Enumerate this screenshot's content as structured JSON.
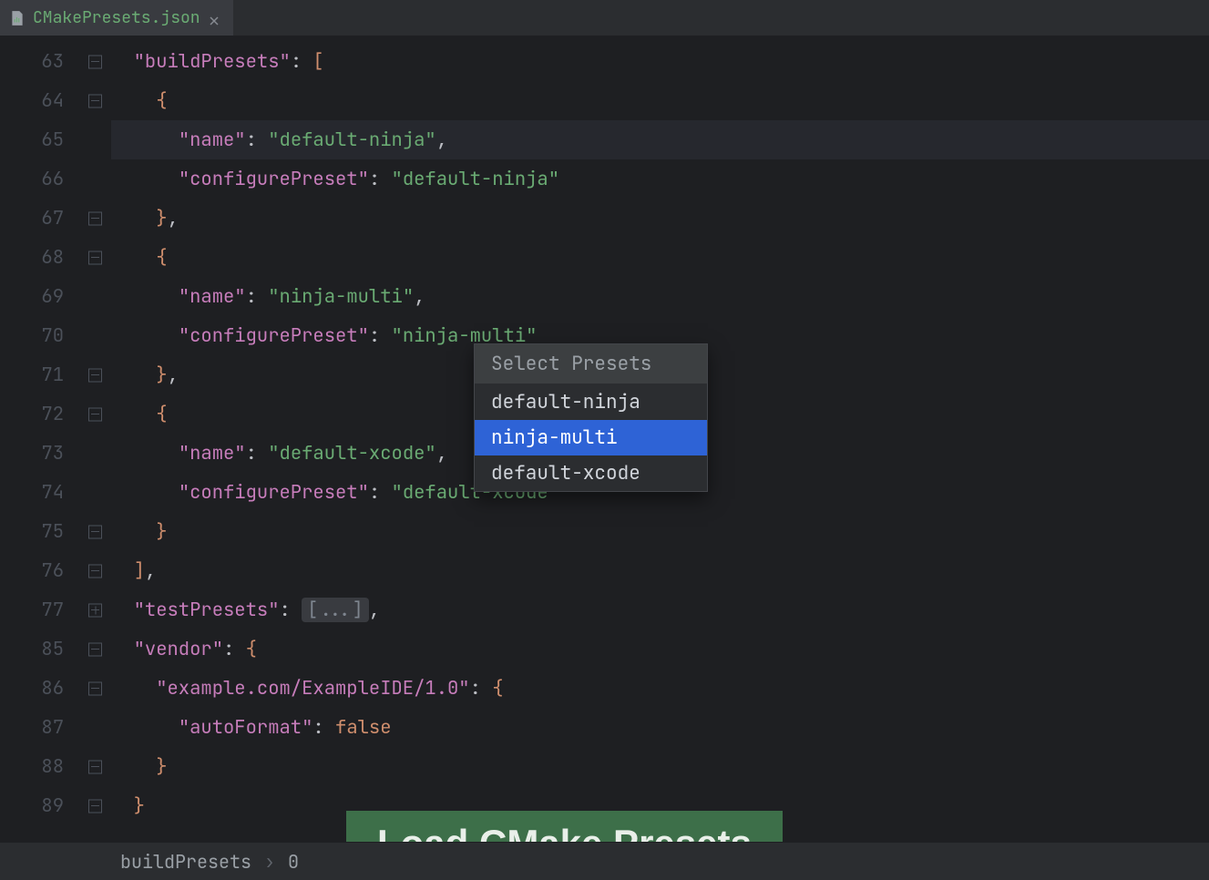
{
  "tab": {
    "filename": "CMakePresets.json"
  },
  "inspection_status": "ok",
  "gutter": [
    {
      "n": "63",
      "marker": "minus"
    },
    {
      "n": "64",
      "marker": "minus"
    },
    {
      "n": "65",
      "marker": null
    },
    {
      "n": "66",
      "marker": null
    },
    {
      "n": "67",
      "marker": "minus"
    },
    {
      "n": "68",
      "marker": "minus"
    },
    {
      "n": "69",
      "marker": null
    },
    {
      "n": "70",
      "marker": null
    },
    {
      "n": "71",
      "marker": "minus"
    },
    {
      "n": "72",
      "marker": "minus"
    },
    {
      "n": "73",
      "marker": null
    },
    {
      "n": "74",
      "marker": null
    },
    {
      "n": "75",
      "marker": "minus"
    },
    {
      "n": "76",
      "marker": "minus"
    },
    {
      "n": "77",
      "marker": "plus"
    },
    {
      "n": "85",
      "marker": "minus"
    },
    {
      "n": "86",
      "marker": "minus"
    },
    {
      "n": "87",
      "marker": null
    },
    {
      "n": "88",
      "marker": "minus"
    },
    {
      "n": "89",
      "marker": "minus"
    }
  ],
  "code": {
    "lines": [
      {
        "indent": 1,
        "tokens": [
          [
            "k",
            "\"buildPresets\""
          ],
          [
            "c",
            ": "
          ],
          [
            "p",
            "["
          ]
        ]
      },
      {
        "indent": 2,
        "tokens": [
          [
            "p",
            "{"
          ]
        ]
      },
      {
        "indent": 3,
        "tokens": [
          [
            "k",
            "\"name\""
          ],
          [
            "c",
            ": "
          ],
          [
            "s",
            "\"default-ninja\""
          ],
          [
            "c",
            ","
          ]
        ],
        "hl": true
      },
      {
        "indent": 3,
        "tokens": [
          [
            "k",
            "\"configurePreset\""
          ],
          [
            "c",
            ": "
          ],
          [
            "s",
            "\"default-ninja\""
          ]
        ]
      },
      {
        "indent": 2,
        "tokens": [
          [
            "p",
            "}"
          ],
          [
            "c",
            ","
          ]
        ]
      },
      {
        "indent": 2,
        "tokens": [
          [
            "p",
            "{"
          ]
        ]
      },
      {
        "indent": 3,
        "tokens": [
          [
            "k",
            "\"name\""
          ],
          [
            "c",
            ": "
          ],
          [
            "s",
            "\"ninja-multi\""
          ],
          [
            "c",
            ","
          ]
        ]
      },
      {
        "indent": 3,
        "tokens": [
          [
            "k",
            "\"configurePreset\""
          ],
          [
            "c",
            ": "
          ],
          [
            "s",
            "\"ninja-multi\""
          ]
        ]
      },
      {
        "indent": 2,
        "tokens": [
          [
            "p",
            "}"
          ],
          [
            "c",
            ","
          ]
        ]
      },
      {
        "indent": 2,
        "tokens": [
          [
            "p",
            "{"
          ]
        ]
      },
      {
        "indent": 3,
        "tokens": [
          [
            "k",
            "\"name\""
          ],
          [
            "c",
            ": "
          ],
          [
            "s",
            "\"default-xcode\""
          ],
          [
            "c",
            ","
          ]
        ]
      },
      {
        "indent": 3,
        "tokens": [
          [
            "k",
            "\"configurePreset\""
          ],
          [
            "c",
            ": "
          ],
          [
            "s",
            "\"default-xcode\""
          ]
        ]
      },
      {
        "indent": 2,
        "tokens": [
          [
            "p",
            "}"
          ]
        ]
      },
      {
        "indent": 1,
        "tokens": [
          [
            "p",
            "]"
          ],
          [
            "c",
            ","
          ]
        ]
      },
      {
        "indent": 1,
        "tokens": [
          [
            "k",
            "\"testPresets\""
          ],
          [
            "c",
            ": "
          ],
          [
            "fold",
            "[...]"
          ],
          [
            "c",
            ","
          ]
        ]
      },
      {
        "indent": 1,
        "tokens": [
          [
            "k",
            "\"vendor\""
          ],
          [
            "c",
            ": "
          ],
          [
            "p",
            "{"
          ]
        ]
      },
      {
        "indent": 2,
        "tokens": [
          [
            "k",
            "\"example.com/ExampleIDE/1.0\""
          ],
          [
            "c",
            ": "
          ],
          [
            "p",
            "{"
          ]
        ]
      },
      {
        "indent": 3,
        "tokens": [
          [
            "k",
            "\"autoFormat\""
          ],
          [
            "c",
            ": "
          ],
          [
            "b",
            "false"
          ]
        ]
      },
      {
        "indent": 2,
        "tokens": [
          [
            "p",
            "}"
          ]
        ]
      },
      {
        "indent": 1,
        "tokens": [
          [
            "p",
            "}"
          ]
        ]
      }
    ]
  },
  "popup": {
    "title": "Select Presets",
    "items": [
      {
        "label": "default-ninja",
        "selected": false
      },
      {
        "label": "ninja-multi",
        "selected": true
      },
      {
        "label": "default-xcode",
        "selected": false
      }
    ]
  },
  "banner": {
    "text": "Load CMake Presets"
  },
  "breadcrumb": {
    "path": "buildPresets",
    "index": "0"
  }
}
